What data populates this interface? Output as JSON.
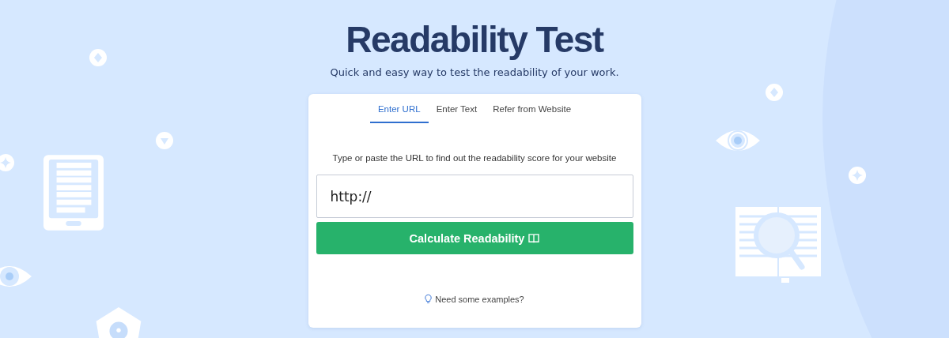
{
  "header": {
    "title": "Readability Test",
    "subtitle": "Quick and easy way to test the readability of your work."
  },
  "tabs": [
    {
      "label": "Enter URL",
      "selected": true
    },
    {
      "label": "Enter Text",
      "selected": false
    },
    {
      "label": "Refer from Website",
      "selected": false
    }
  ],
  "instructions": "Type or paste the URL to find out the readability score for your website",
  "url_field": {
    "value": "http://"
  },
  "calculate_button": {
    "label": "Calculate Readability"
  },
  "examples_link": {
    "label": "Need some examples?"
  }
}
